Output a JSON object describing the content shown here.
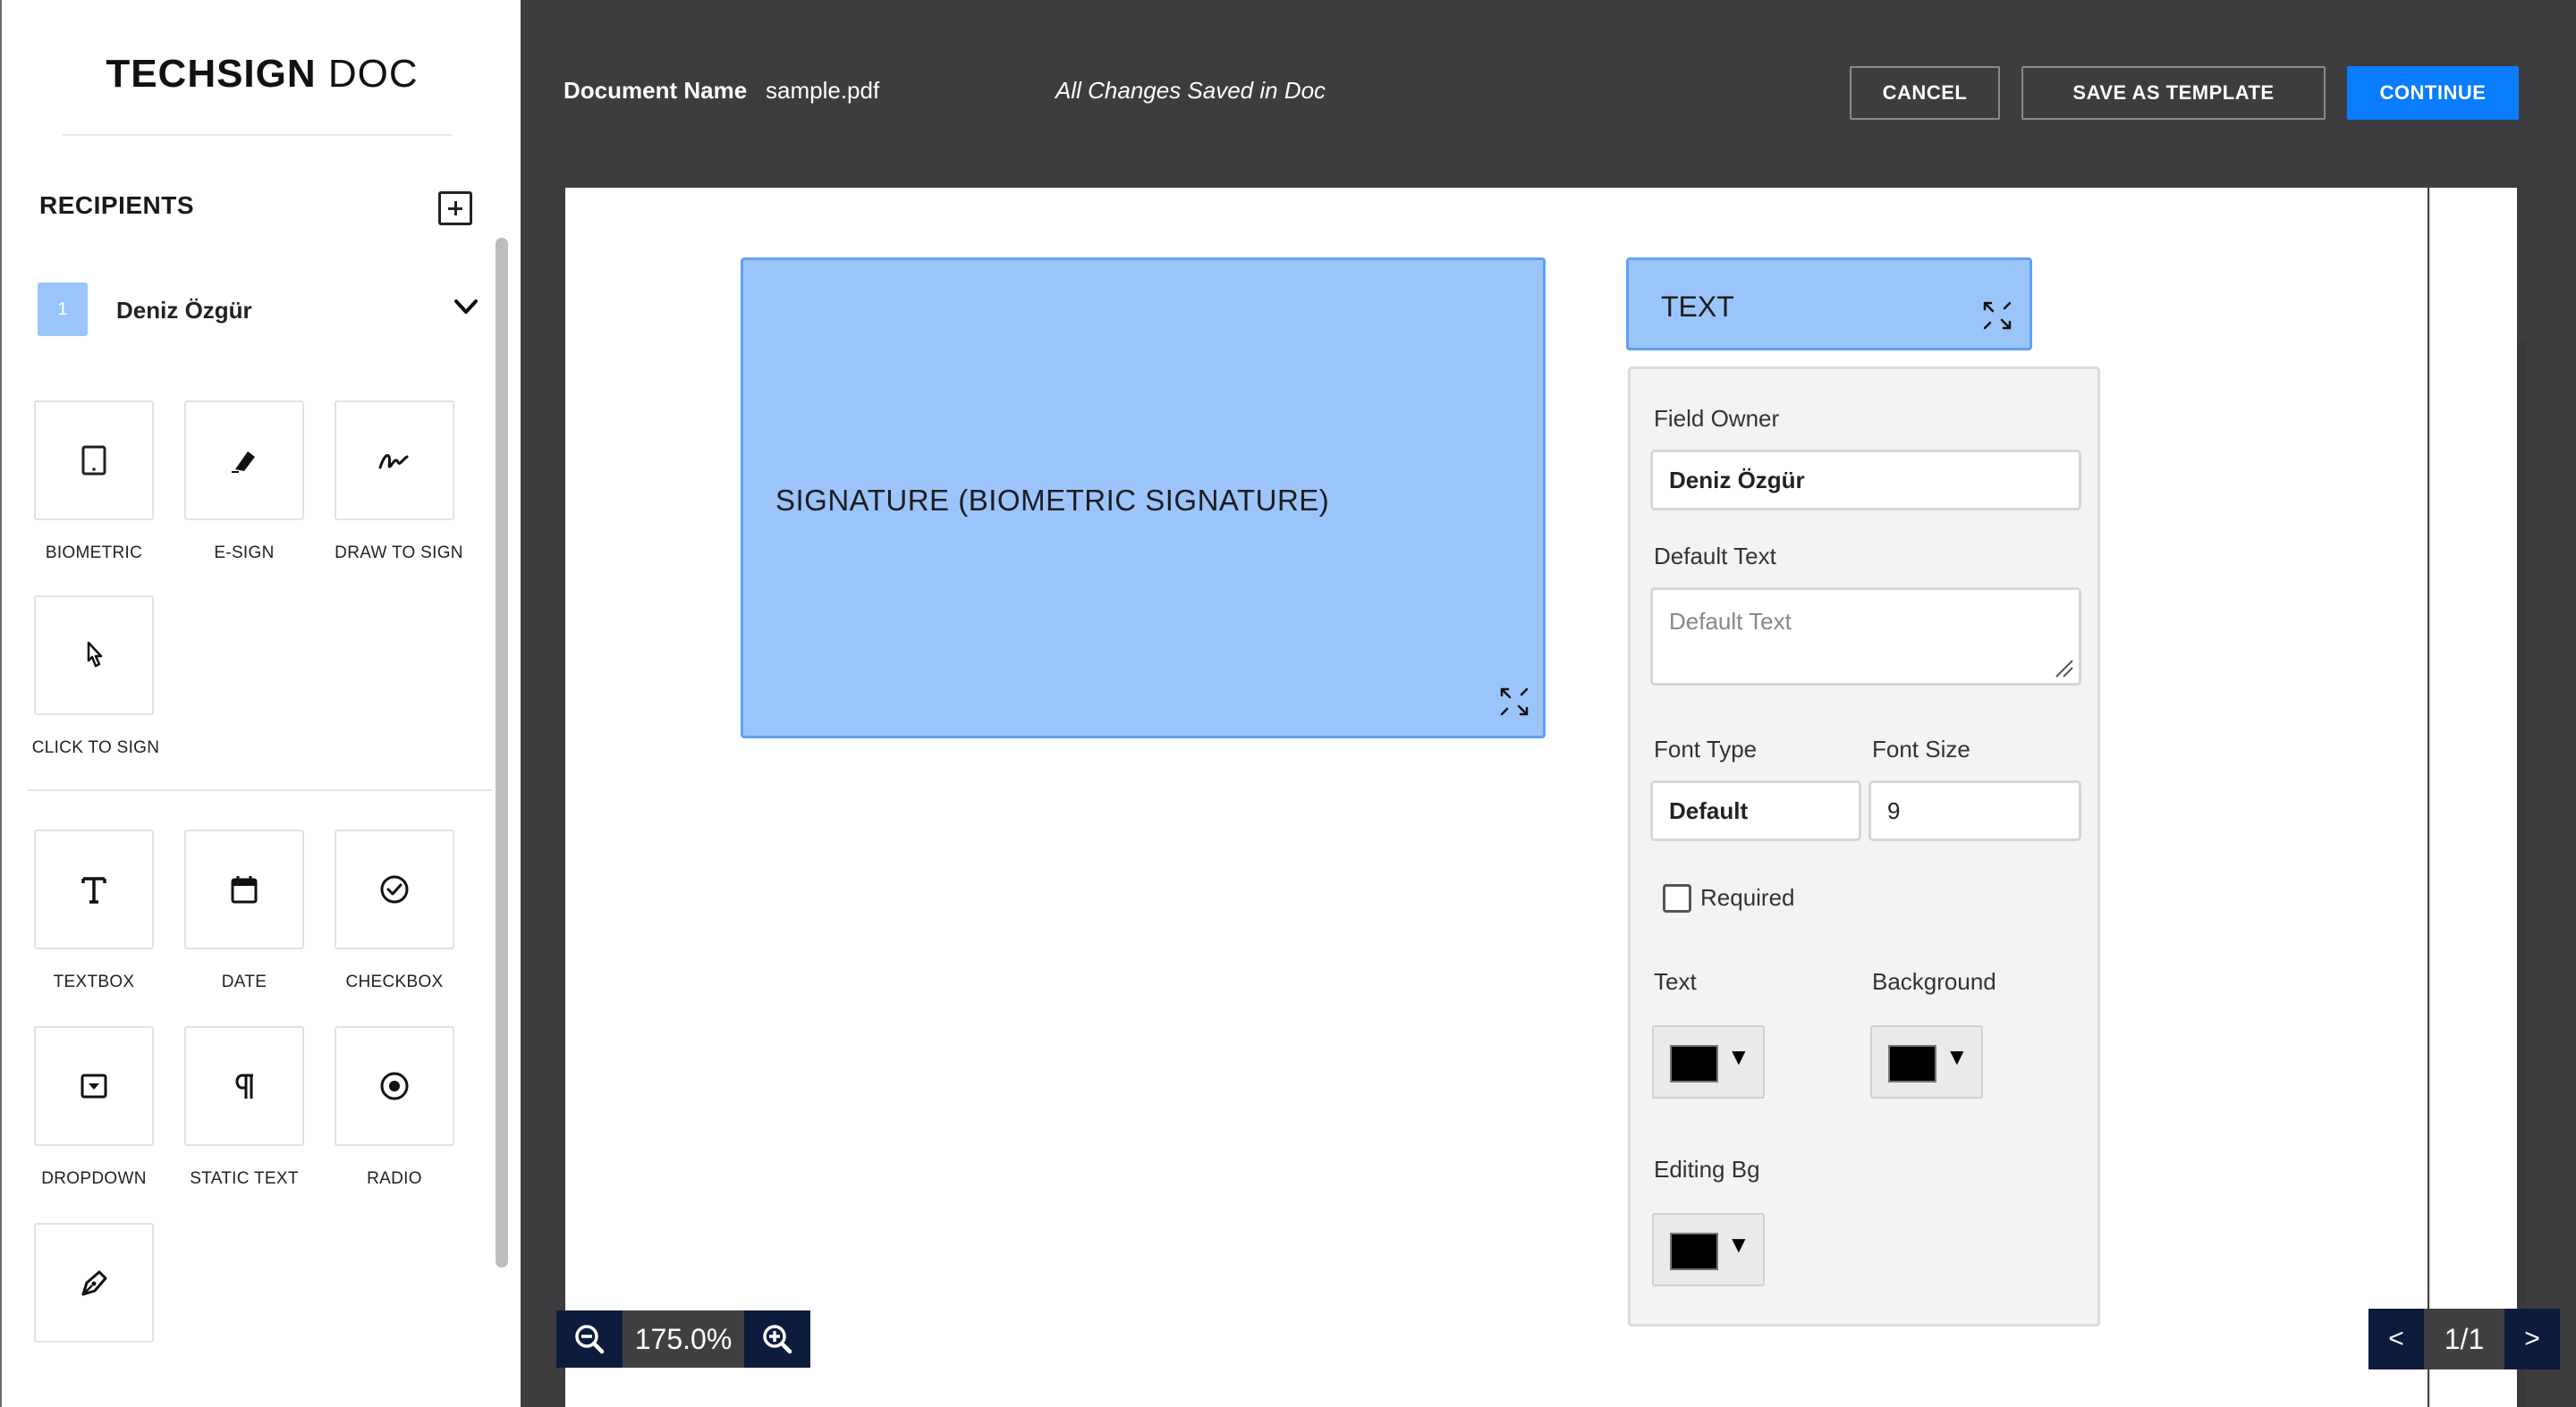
{
  "sidebar": {
    "logo_bold": "TECHSIGN",
    "logo_light": "DOC",
    "recipients_title": "RECIPIENTS",
    "recipient": {
      "number": "1",
      "name": "Deniz Özgür",
      "color": "#9bc4fb"
    },
    "signature_tools": [
      {
        "label": "BIOMETRIC",
        "icon": "tablet-icon"
      },
      {
        "label": "E-SIGN",
        "icon": "eraser-icon"
      },
      {
        "label": "DRAW TO SIGN",
        "icon": "signature-scribble-icon"
      },
      {
        "label": "CLICK TO SIGN",
        "icon": "pointer-hand-icon"
      }
    ],
    "field_tools": [
      {
        "label": "TEXTBOX",
        "icon": "text-t-icon"
      },
      {
        "label": "DATE",
        "icon": "calendar-icon"
      },
      {
        "label": "CHECKBOX",
        "icon": "check-circle-icon"
      },
      {
        "label": "DROPDOWN",
        "icon": "dropdown-icon"
      },
      {
        "label": "STATIC TEXT",
        "icon": "pilcrow-icon"
      },
      {
        "label": "RADIO",
        "icon": "radio-icon"
      },
      {
        "label": "",
        "icon": "pen-nib-icon"
      }
    ]
  },
  "header": {
    "doc_label": "Document Name",
    "doc_name": "sample.pdf",
    "status": "All Changes Saved in Doc",
    "cancel": "CANCEL",
    "save_template": "SAVE AS TEMPLATE",
    "continue": "CONTINUE",
    "accent": "#0a7cff"
  },
  "canvas": {
    "signature_field": "SIGNATURE (BIOMETRIC SIGNATURE)",
    "text_field": "TEXT",
    "field_color": "#9bc4fb"
  },
  "panel": {
    "field_owner_label": "Field Owner",
    "field_owner_value": "Deniz Özgür",
    "default_text_label": "Default Text",
    "default_text_placeholder": "Default Text",
    "font_type_label": "Font Type",
    "font_type_value": "Default",
    "font_size_label": "Font Size",
    "font_size_value": "9",
    "required_label": "Required",
    "required_checked": false,
    "text_color_label": "Text",
    "background_label": "Background",
    "editing_bg_label": "Editing Bg",
    "text_color": "#000000",
    "background_color": "#000000",
    "editing_bg_color": "#000000",
    "dropdown_arrow": "▼"
  },
  "footer": {
    "zoom": "175.0%",
    "page_prev": "<",
    "page_indicator": "1/1",
    "page_next": ">"
  }
}
